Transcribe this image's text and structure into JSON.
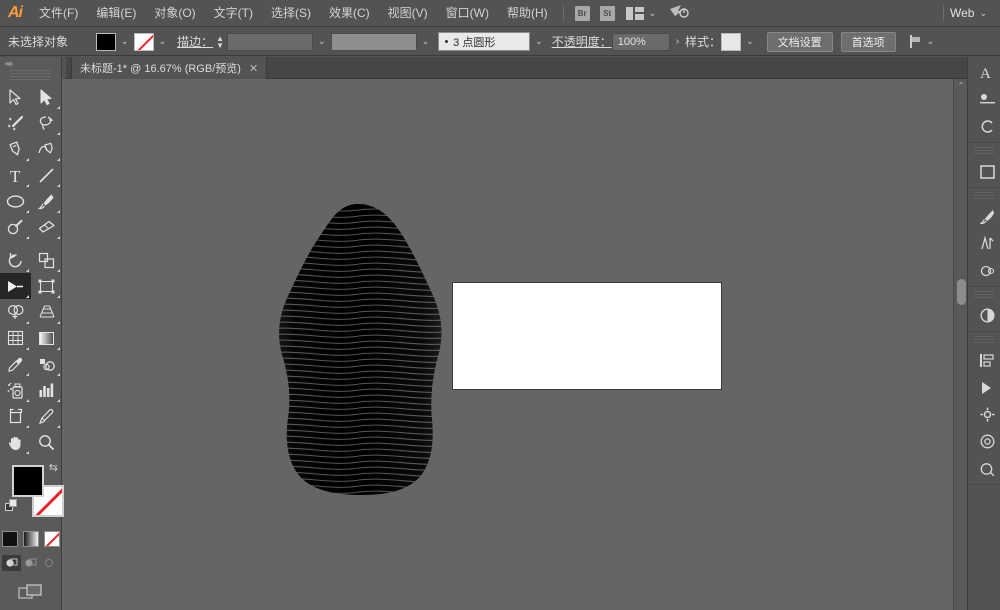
{
  "app": {
    "name": "Adobe Illustrator",
    "logo_text": "Ai",
    "accent_color": "#ff9a3c",
    "bg_color": "#535353",
    "canvas_color": "#656565"
  },
  "menubar": {
    "items": [
      {
        "label": "文件(F)",
        "name": "menu-file"
      },
      {
        "label": "编辑(E)",
        "name": "menu-edit"
      },
      {
        "label": "对象(O)",
        "name": "menu-object"
      },
      {
        "label": "文字(T)",
        "name": "menu-type"
      },
      {
        "label": "选择(S)",
        "name": "menu-select"
      },
      {
        "label": "效果(C)",
        "name": "menu-effect"
      },
      {
        "label": "视图(V)",
        "name": "menu-view"
      },
      {
        "label": "窗口(W)",
        "name": "menu-window"
      },
      {
        "label": "帮助(H)",
        "name": "menu-help"
      }
    ],
    "bridge_label": "Br",
    "stock_label": "St",
    "arrange_caret": "⌄",
    "workspace_label": "Web",
    "workspace_caret": "⌄"
  },
  "controlbar": {
    "selection_status": "未选择对象",
    "fill_swatch_color": "#000000",
    "fill_caret": "⌄",
    "stroke_swatch_label": "none",
    "stroke_caret": "⌄",
    "stroke_label": "描边：",
    "stroke_weight_value": "",
    "stroke_weight_caret": "⌄",
    "stroke_profile_value": "",
    "stroke_profile_caret": "⌄",
    "brush_value": "3 点圆形",
    "brush_caret": "⌄",
    "opacity_label": "不透明度：",
    "opacity_value": "100%",
    "opacity_arrow": "›",
    "style_label": "样式：",
    "style_caret": "⌄",
    "doc_setup_button": "文档设置",
    "preferences_button": "首选项",
    "align_caret": "⌄"
  },
  "tabbar": {
    "document_tab": "未标题-1* @ 16.67% (RGB/预览)",
    "close_glyph": "✕"
  },
  "toolbar": {
    "collapse_glyph": "««",
    "tools": [
      {
        "name": "selection-tool",
        "label": "选择工具",
        "selected": false
      },
      {
        "name": "direct-selection-tool",
        "label": "直接选择工具",
        "selected": false
      },
      {
        "name": "magic-wand-tool",
        "label": "魔棒工具",
        "selected": false
      },
      {
        "name": "lasso-tool",
        "label": "套索工具",
        "selected": false
      },
      {
        "name": "pen-tool",
        "label": "钢笔工具",
        "selected": false
      },
      {
        "name": "curvature-tool",
        "label": "曲率工具",
        "selected": false
      },
      {
        "name": "type-tool",
        "label": "文字工具",
        "selected": false
      },
      {
        "name": "line-segment-tool",
        "label": "直线段工具",
        "selected": false
      },
      {
        "name": "ellipse-tool",
        "label": "椭圆工具",
        "selected": false
      },
      {
        "name": "paintbrush-tool",
        "label": "画笔工具",
        "selected": false
      },
      {
        "name": "pencil-tool",
        "label": "铅笔工具",
        "selected": false
      },
      {
        "name": "eraser-tool",
        "label": "橡皮擦工具",
        "selected": false
      },
      {
        "name": "rotate-tool",
        "label": "旋转工具",
        "selected": false
      },
      {
        "name": "scale-tool",
        "label": "比例缩放工具",
        "selected": false
      },
      {
        "name": "width-tool",
        "label": "宽度工具",
        "selected": true
      },
      {
        "name": "free-transform-tool",
        "label": "自由变换工具",
        "selected": false
      },
      {
        "name": "shape-builder-tool",
        "label": "形状生成器工具",
        "selected": false
      },
      {
        "name": "perspective-grid-tool",
        "label": "透视网格工具",
        "selected": false
      },
      {
        "name": "mesh-tool",
        "label": "网格工具",
        "selected": false
      },
      {
        "name": "gradient-tool",
        "label": "渐变工具",
        "selected": false
      },
      {
        "name": "eyedropper-tool",
        "label": "吸管工具",
        "selected": false
      },
      {
        "name": "blend-tool",
        "label": "混合工具",
        "selected": false
      },
      {
        "name": "symbol-sprayer-tool",
        "label": "符号喷枪工具",
        "selected": false
      },
      {
        "name": "column-graph-tool",
        "label": "柱形图工具",
        "selected": false
      },
      {
        "name": "artboard-tool",
        "label": "画板工具",
        "selected": false
      },
      {
        "name": "slice-tool",
        "label": "切片工具",
        "selected": false
      },
      {
        "name": "hand-tool",
        "label": "抓手工具",
        "selected": false
      },
      {
        "name": "zoom-tool",
        "label": "缩放工具",
        "selected": false
      }
    ],
    "fill_color": "#000000",
    "stroke_color": "none",
    "swap_glyph": "⇆",
    "paint_modes": [
      {
        "name": "color-mode",
        "label": "颜色"
      },
      {
        "name": "gradient-mode",
        "label": "渐变"
      },
      {
        "name": "none-mode",
        "label": "无"
      }
    ],
    "draw_modes": [
      {
        "name": "draw-normal-mode",
        "label": "正常绘图",
        "selected": true
      },
      {
        "name": "draw-behind-mode",
        "label": "背面绘图",
        "selected": false
      },
      {
        "name": "draw-inside-mode",
        "label": "内部绘图",
        "selected": false
      }
    ],
    "screen_mode_label": "更改屏幕模式"
  },
  "canvas": {
    "zoom": "16.67%",
    "artboard_fill": "#ffffff",
    "artboard_border": "#3a3a3a",
    "artwork_name": "线条人像图稿",
    "artwork_color": "#000000"
  },
  "rightdock": {
    "panels": [
      {
        "name": "character-panel-icon",
        "label": "字符"
      },
      {
        "name": "paragraph-panel-icon",
        "label": "段落"
      },
      {
        "name": "opentype-panel-icon",
        "label": "OpenType"
      },
      {
        "name": "artboards-panel-icon",
        "label": "画板"
      },
      {
        "name": "brushes-panel-icon",
        "label": "画笔"
      },
      {
        "name": "symbols-panel-icon",
        "label": "符号"
      },
      {
        "name": "graphic-styles-panel-icon",
        "label": "图形样式"
      },
      {
        "name": "color-panel-icon",
        "label": "颜色"
      },
      {
        "name": "align-panel-icon",
        "label": "对齐"
      },
      {
        "name": "pathfinder-panel-icon",
        "label": "路径查找器"
      },
      {
        "name": "transform-panel-icon",
        "label": "变换"
      },
      {
        "name": "appearance-panel-icon",
        "label": "外观"
      },
      {
        "name": "transparency-panel-icon",
        "label": "透明度"
      },
      {
        "name": "links-panel-icon",
        "label": "链接"
      }
    ]
  }
}
